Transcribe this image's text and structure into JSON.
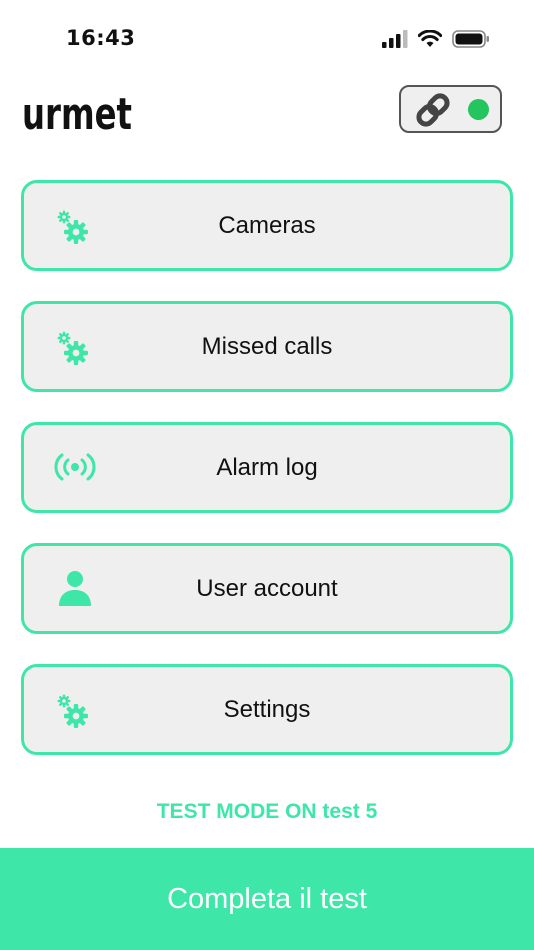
{
  "status_bar": {
    "time": "16:43",
    "icons": [
      "cellular-signal-icon",
      "wifi-icon",
      "battery-icon"
    ]
  },
  "header": {
    "logo_text": "urmet",
    "connection_icon": "link-icon",
    "connection_status_color": "#22c55e"
  },
  "colors": {
    "accent": "#3ee6a8",
    "button_bg": "#efefef",
    "status_green": "#22c55e"
  },
  "menu": {
    "items": [
      {
        "label": "Cameras",
        "icon": "gears-icon"
      },
      {
        "label": "Missed calls",
        "icon": "gears-icon"
      },
      {
        "label": "Alarm log",
        "icon": "alarm-broadcast-icon"
      },
      {
        "label": "User account",
        "icon": "user-icon"
      },
      {
        "label": "Settings",
        "icon": "gears-icon"
      }
    ]
  },
  "test_mode_text": "TEST MODE ON test 5",
  "footer": {
    "button_label": "Completa il test"
  }
}
